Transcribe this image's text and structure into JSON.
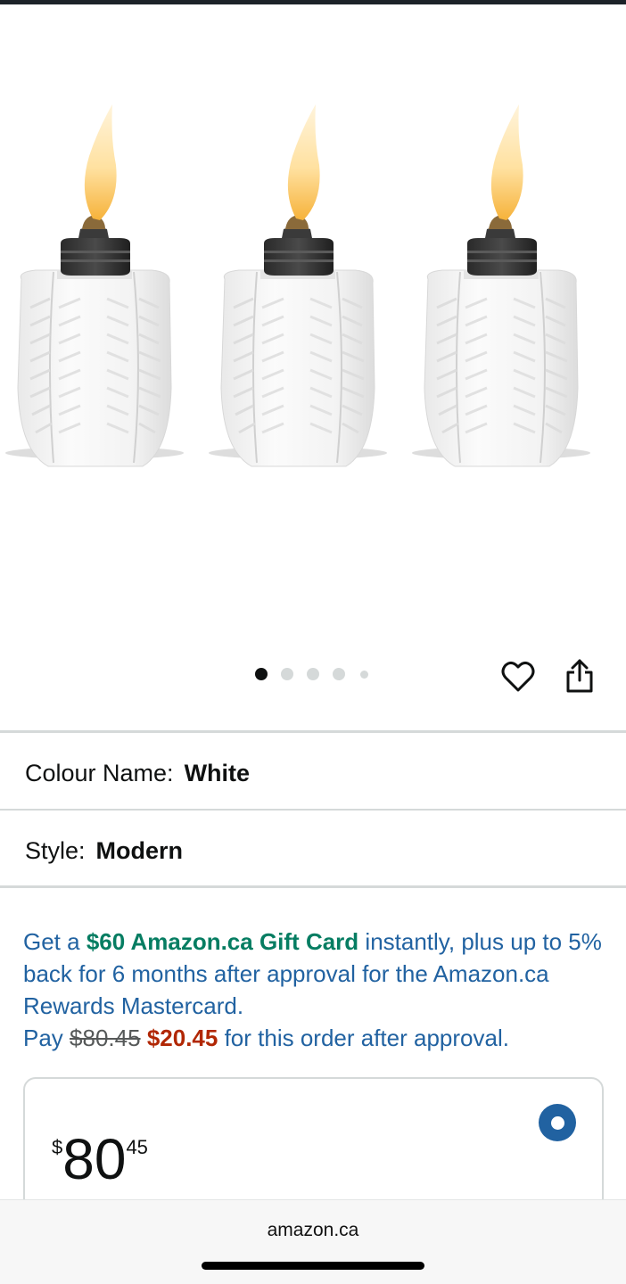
{
  "product": {
    "gallery": {
      "image_name": "white-ceramic-tabletop-torches",
      "dot_count": 5,
      "active_index": 0
    },
    "variants": {
      "colour": {
        "label": "Colour Name:",
        "value": "White"
      },
      "style": {
        "label": "Style:",
        "value": "Modern"
      }
    }
  },
  "promo": {
    "prefix": "Get a",
    "gift_card": "$60 Amazon.ca Gift Card",
    "middle": "instantly, plus up to 5% back for 6 months after approval for the Amazon.ca Rewards Mastercard.",
    "pay_prefix": "Pay",
    "original_price": "$80.45",
    "discounted_price": "$20.45",
    "pay_suffix": "for this order after approval."
  },
  "price_option": {
    "currency_symbol": "$",
    "whole": "80",
    "fraction": "45",
    "selected": true
  },
  "browser": {
    "url": "amazon.ca"
  },
  "icons": {
    "wishlist": "heart-icon",
    "share": "share-icon",
    "radio": "radio-selected-icon"
  },
  "colors": {
    "link_blue": "#2162a1",
    "promo_green": "#067d62",
    "price_red": "#b12704"
  }
}
